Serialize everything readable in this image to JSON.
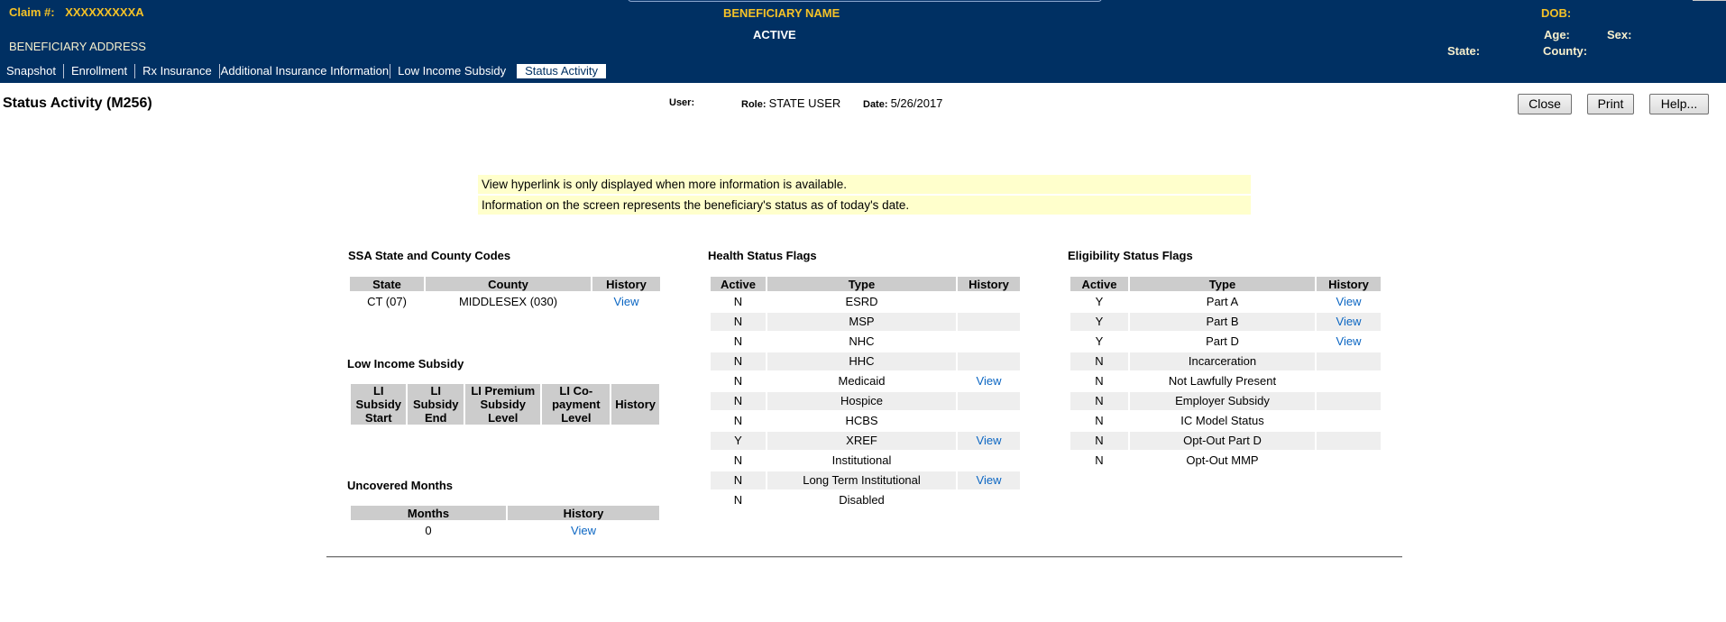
{
  "header": {
    "claim_label": "Claim #:",
    "claim_value": "XXXXXXXXXA",
    "beneficiary_address": "BENEFICIARY ADDRESS",
    "beneficiary_name": "BENEFICIARY NAME",
    "status": "ACTIVE",
    "dob_label": "DOB:",
    "age_label": "Age:",
    "sex_label": "Sex:",
    "state_label": "State:",
    "county_label": "County:"
  },
  "tabs": [
    {
      "label": "Snapshot",
      "active": false
    },
    {
      "label": "Enrollment",
      "active": false
    },
    {
      "label": "Rx Insurance",
      "active": false
    },
    {
      "label": "Additional Insurance Information",
      "active": false
    },
    {
      "label": "Low Income Subsidy",
      "active": false
    },
    {
      "label": "Status Activity",
      "active": true
    }
  ],
  "page": {
    "title": "Status Activity (M256)",
    "user_label": "User:",
    "role_label": "Role:",
    "role_value": "STATE USER",
    "date_label": "Date:",
    "date_value": "5/26/2017"
  },
  "buttons": {
    "close": "Close",
    "print": "Print",
    "help": "Help..."
  },
  "notices": [
    "View hyperlink is only displayed when more information is available.",
    "Information on the screen represents the beneficiary's status as of today's date."
  ],
  "ssa_codes": {
    "title": "SSA State and County Codes",
    "columns": [
      "State",
      "County",
      "History"
    ],
    "rows": [
      {
        "state": "CT (07)",
        "county": "MIDDLESEX (030)",
        "history": "View"
      }
    ]
  },
  "low_income_subsidy": {
    "title": "Low Income Subsidy",
    "columns": [
      "LI Subsidy Start",
      "LI Subsidy End",
      "LI Premium Subsidy Level",
      "LI Co-payment Level",
      "History"
    ],
    "rows": []
  },
  "uncovered_months": {
    "title": "Uncovered Months",
    "columns": [
      "Months",
      "History"
    ],
    "rows": [
      {
        "months": "0",
        "history": "View"
      }
    ]
  },
  "health_status_flags": {
    "title": "Health Status Flags",
    "columns": [
      "Active",
      "Type",
      "History"
    ],
    "rows": [
      {
        "active": "N",
        "type": "ESRD",
        "history": ""
      },
      {
        "active": "N",
        "type": "MSP",
        "history": ""
      },
      {
        "active": "N",
        "type": "NHC",
        "history": ""
      },
      {
        "active": "N",
        "type": "HHC",
        "history": ""
      },
      {
        "active": "N",
        "type": "Medicaid",
        "history": "View"
      },
      {
        "active": "N",
        "type": "Hospice",
        "history": ""
      },
      {
        "active": "N",
        "type": "HCBS",
        "history": ""
      },
      {
        "active": "Y",
        "type": "XREF",
        "history": "View"
      },
      {
        "active": "N",
        "type": "Institutional",
        "history": ""
      },
      {
        "active": "N",
        "type": "Long Term Institutional",
        "history": "View"
      },
      {
        "active": "N",
        "type": "Disabled",
        "history": ""
      }
    ]
  },
  "eligibility_status_flags": {
    "title": "Eligibility Status Flags",
    "columns": [
      "Active",
      "Type",
      "History"
    ],
    "rows": [
      {
        "active": "Y",
        "type": "Part A",
        "history": "View"
      },
      {
        "active": "Y",
        "type": "Part B",
        "history": "View"
      },
      {
        "active": "Y",
        "type": "Part D",
        "history": "View"
      },
      {
        "active": "N",
        "type": "Incarceration",
        "history": ""
      },
      {
        "active": "N",
        "type": "Not Lawfully Present",
        "history": ""
      },
      {
        "active": "N",
        "type": "Employer Subsidy",
        "history": ""
      },
      {
        "active": "N",
        "type": "IC Model Status",
        "history": ""
      },
      {
        "active": "N",
        "type": "Opt-Out Part D",
        "history": ""
      },
      {
        "active": "N",
        "type": "Opt-Out MMP",
        "history": ""
      }
    ]
  },
  "colors": {
    "header_bg": "#003063",
    "header_gold": "#f5c227",
    "header_cream": "#f7efcd",
    "link": "#0b66c3",
    "notice_bg": "#ffffcc",
    "table_header_bg": "#cccccc",
    "table_alt_row_bg": "#eeeeee"
  }
}
